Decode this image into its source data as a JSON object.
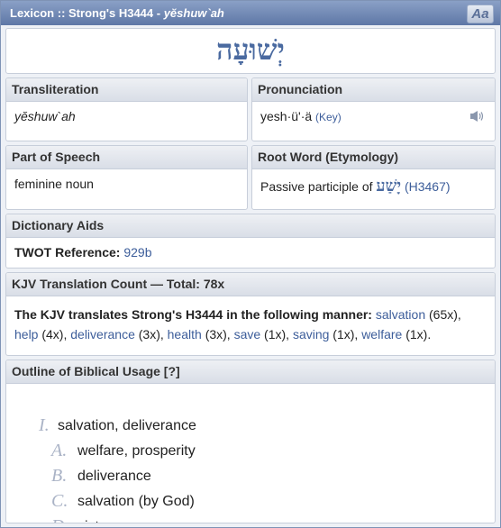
{
  "window": {
    "title_prefix": "Lexicon :: Strong's H3444 - ",
    "title_translit": "yĕshuw`ah",
    "font_button": "Aa"
  },
  "headword": "יְשׁוּעָה",
  "transliteration": {
    "label": "Transliteration",
    "value": "yĕshuw`ah"
  },
  "pronunciation": {
    "label": "Pronunciation",
    "value": "yesh·ü'·ä",
    "key_link": "(Key)",
    "speaker_icon": "speaker-icon"
  },
  "part_of_speech": {
    "label": "Part of Speech",
    "value": "feminine noun"
  },
  "root_word": {
    "label": "Root Word (Etymology)",
    "prefix": "Passive participle of",
    "hebrew": "יָשַׁע",
    "ref": "(H3467)"
  },
  "dictionary_aids": {
    "label": "Dictionary Aids",
    "twot_label": "TWOT Reference:",
    "twot_value": "929b"
  },
  "kjv": {
    "label": "KJV Translation Count — Total: 78x",
    "intro": "The KJV translates Strong's H3444 in the following manner:",
    "items": [
      {
        "word": "salvation",
        "count": "(65x),"
      },
      {
        "word": "help",
        "count": "(4x),"
      },
      {
        "word": "deliverance",
        "count": "(3x),"
      },
      {
        "word": "health",
        "count": "(3x),"
      },
      {
        "word": "save",
        "count": "(1x),"
      },
      {
        "word": "saving",
        "count": "(1x),"
      },
      {
        "word": "welfare",
        "count": "(1x)."
      }
    ]
  },
  "outline": {
    "label": "Outline of Biblical Usage [?]",
    "items": [
      {
        "mark": "I.",
        "text": "salvation, deliverance"
      },
      {
        "mark": "A.",
        "text": "welfare, prosperity"
      },
      {
        "mark": "B.",
        "text": "deliverance"
      },
      {
        "mark": "C.",
        "text": "salvation (by God)"
      },
      {
        "mark": "D.",
        "text": "victory"
      }
    ]
  }
}
